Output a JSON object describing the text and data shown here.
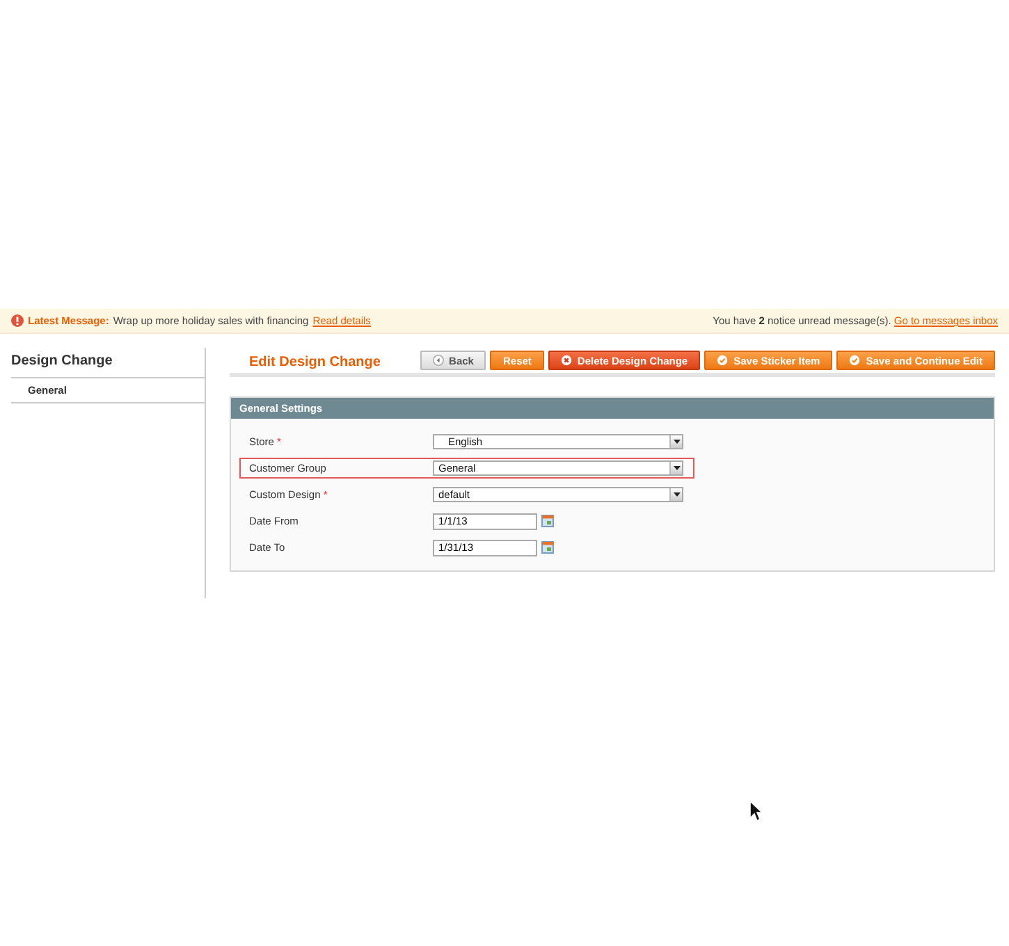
{
  "message_bar": {
    "label": "Latest Message:",
    "text": "Wrap up more holiday sales with financing",
    "link": "Read details",
    "notice_before": "You have",
    "notice_count": "2",
    "notice_after": "notice unread message(s).",
    "notice_link": "Go to messages inbox"
  },
  "sidebar": {
    "title": "Design Change",
    "items": [
      {
        "label": "General",
        "selected": true
      }
    ]
  },
  "header": {
    "title": "Edit Design Change",
    "buttons": [
      {
        "label": "Back",
        "kind": "back"
      },
      {
        "label": "Reset",
        "kind": "reset"
      },
      {
        "label": "Delete Design Change",
        "kind": "delete"
      },
      {
        "label": "Save Sticker Item",
        "kind": "save"
      },
      {
        "label": "Save and Continue Edit",
        "kind": "save"
      }
    ]
  },
  "fieldset": {
    "title": "General Settings",
    "fields": [
      {
        "label": "Store",
        "required_mark": "*",
        "kind": "select",
        "value": "English",
        "highlighted": false
      },
      {
        "label": "Customer Group",
        "kind": "select",
        "value": "General",
        "highlighted": true
      },
      {
        "label": "Custom Design",
        "required_mark": "*",
        "kind": "select",
        "value": "default",
        "highlighted": false
      },
      {
        "label": "Date From",
        "kind": "date",
        "value": "1/1/13",
        "highlighted": false
      },
      {
        "label": "Date To",
        "kind": "date",
        "value": "1/31/13",
        "highlighted": false
      }
    ]
  }
}
